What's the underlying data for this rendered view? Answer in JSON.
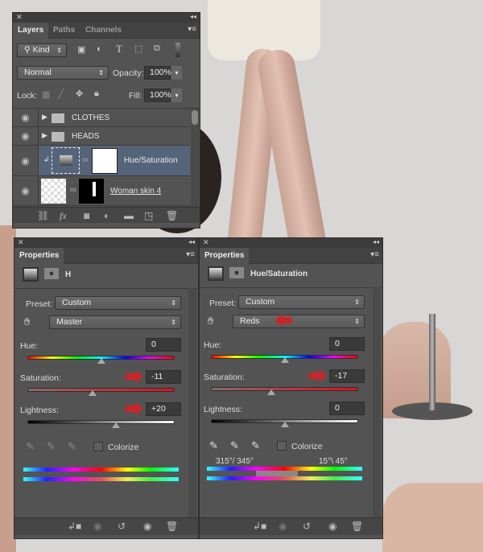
{
  "layers_panel": {
    "tabs": [
      "Layers",
      "Paths",
      "Channels"
    ],
    "filter_kind": "Kind",
    "blend_mode": "Normal",
    "opacity_label": "Opacity:",
    "opacity": "100%",
    "lock_label": "Lock:",
    "fill_label": "Fill:",
    "fill": "100%",
    "layers": [
      {
        "name": "CLOTHES",
        "type": "group"
      },
      {
        "name": "HEADS",
        "type": "group"
      },
      {
        "name": "Hue/Saturation",
        "type": "adjustment",
        "selected": true
      },
      {
        "name": "Woman skin 4",
        "type": "layer"
      }
    ]
  },
  "properties_left": {
    "tab": "Properties",
    "title": "H",
    "preset_label": "Preset:",
    "preset": "Custom",
    "channel": "Master",
    "hue_label": "Hue:",
    "hue": "0",
    "hue_pos": 0.5,
    "saturation_label": "Saturation:",
    "saturation": "-11",
    "saturation_pos": 0.44,
    "lightness_label": "Lightness:",
    "lightness": "+20",
    "lightness_pos": 0.6,
    "colorize_label": "Colorize"
  },
  "properties_right": {
    "tab": "Properties",
    "title": "Hue/Saturation",
    "preset_label": "Preset:",
    "preset": "Custom",
    "channel": "Reds",
    "hue_label": "Hue:",
    "hue": "0",
    "hue_pos": 0.5,
    "saturation_label": "Saturation:",
    "saturation": "-17",
    "saturation_pos": 0.41,
    "lightness_label": "Lightness:",
    "lightness": "0",
    "lightness_pos": 0.5,
    "colorize_label": "Colorize",
    "range_left": "315°/ 345°",
    "range_right": "15°\\ 45°"
  },
  "colors": {
    "panel": "#535353",
    "selected_row": "#56647a",
    "arrow": "#c8262a"
  }
}
